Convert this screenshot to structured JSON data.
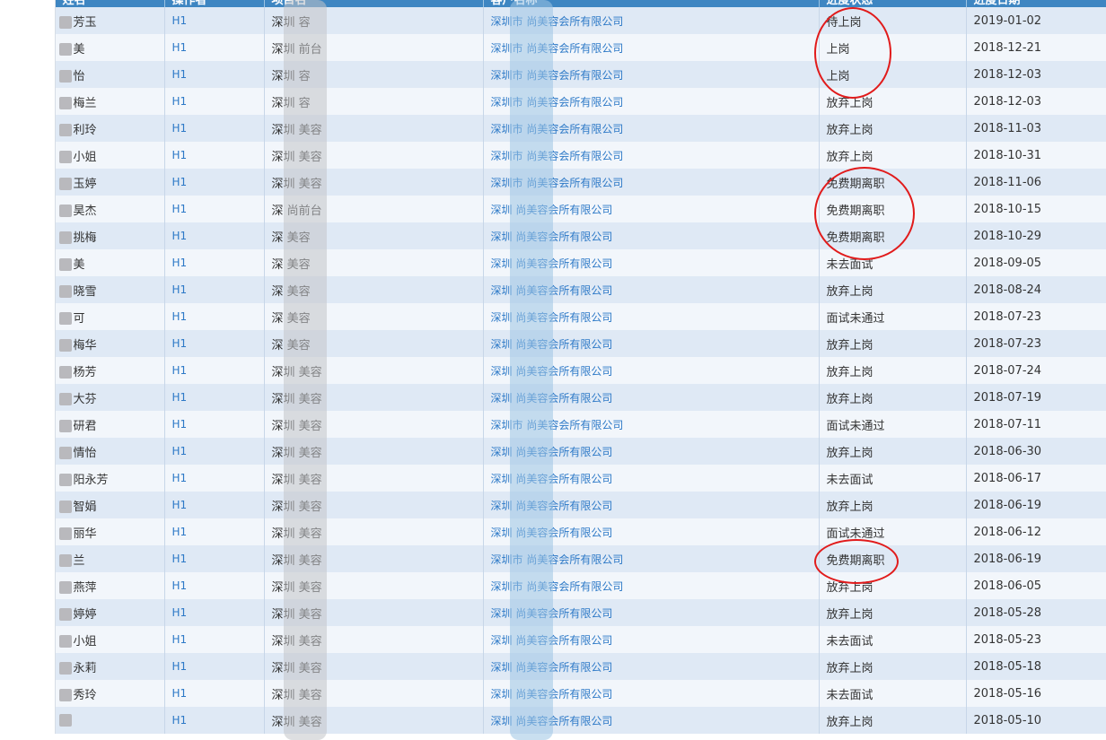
{
  "header": {
    "columns": [
      "姓名",
      "操作者",
      "项目名",
      "客户名称",
      "进度状态",
      "进度日期"
    ]
  },
  "rows": [
    {
      "name": "芳玉",
      "operator": "H1",
      "project": "深圳  容",
      "client": "深圳市  尚美容会所有限公司",
      "status": "待上岗",
      "date": "2019-01-02"
    },
    {
      "name": "美",
      "operator": "H1",
      "project": "深圳  前台",
      "client": "深圳市  尚美容会所有限公司",
      "status": "上岗",
      "date": "2018-12-21"
    },
    {
      "name": "怡",
      "operator": "H1",
      "project": "深圳  容",
      "client": "深圳市  尚美容会所有限公司",
      "status": "上岗",
      "date": "2018-12-03"
    },
    {
      "name": "梅兰",
      "operator": "H1",
      "project": "深圳  容",
      "client": "深圳市  尚美容会所有限公司",
      "status": "放弃上岗",
      "date": "2018-12-03"
    },
    {
      "name": "利玲",
      "operator": "H1",
      "project": "深圳  美容",
      "client": "深圳市  尚美容会所有限公司",
      "status": "放弃上岗",
      "date": "2018-11-03"
    },
    {
      "name": "小姐",
      "operator": "H1",
      "project": "深圳  美容",
      "client": "深圳市  尚美容会所有限公司",
      "status": "放弃上岗",
      "date": "2018-10-31"
    },
    {
      "name": "玉婷",
      "operator": "H1",
      "project": "深圳  美容",
      "client": "深圳市  尚美容会所有限公司",
      "status": "免费期离职",
      "date": "2018-11-06"
    },
    {
      "name": "昊杰",
      "operator": "H1",
      "project": "深  尚前台",
      "client": "深圳  尚美容会所有限公司",
      "status": "免费期离职",
      "date": "2018-10-15"
    },
    {
      "name": "挑梅",
      "operator": "H1",
      "project": "深  美容",
      "client": "深圳  尚美容会所有限公司",
      "status": "免费期离职",
      "date": "2018-10-29"
    },
    {
      "name": "美",
      "operator": "H1",
      "project": "深  美容",
      "client": "深圳  尚美容会所有限公司",
      "status": "未去面试",
      "date": "2018-09-05"
    },
    {
      "name": "晓雪",
      "operator": "H1",
      "project": "深  美容",
      "client": "深圳  尚美容会所有限公司",
      "status": "放弃上岗",
      "date": "2018-08-24"
    },
    {
      "name": "可",
      "operator": "H1",
      "project": "深  美容",
      "client": "深圳  尚美容会所有限公司",
      "status": "面试未通过",
      "date": "2018-07-23"
    },
    {
      "name": "梅华",
      "operator": "H1",
      "project": "深  美容",
      "client": "深圳  尚美容会所有限公司",
      "status": "放弃上岗",
      "date": "2018-07-23"
    },
    {
      "name": "杨芳",
      "operator": "H1",
      "project": "深圳  美容",
      "client": "深圳  尚美容会所有限公司",
      "status": "放弃上岗",
      "date": "2018-07-24"
    },
    {
      "name": "大芬",
      "operator": "H1",
      "project": "深圳  美容",
      "client": "深圳  尚美容会所有限公司",
      "status": "放弃上岗",
      "date": "2018-07-19"
    },
    {
      "name": "研君",
      "operator": "H1",
      "project": "深圳  美容",
      "client": "深圳市  尚美容会所有限公司",
      "status": "面试未通过",
      "date": "2018-07-11"
    },
    {
      "name": "情怡",
      "operator": "H1",
      "project": "深圳  美容",
      "client": "深圳  尚美容会所有限公司",
      "status": "放弃上岗",
      "date": "2018-06-30"
    },
    {
      "name": "阳永芳",
      "operator": "H1",
      "project": "深圳  美容",
      "client": "深圳  尚美容会所有限公司",
      "status": "未去面试",
      "date": "2018-06-17"
    },
    {
      "name": "智娟",
      "operator": "H1",
      "project": "深圳  美容",
      "client": "深圳  尚美容会所有限公司",
      "status": "放弃上岗",
      "date": "2018-06-19"
    },
    {
      "name": "丽华",
      "operator": "H1",
      "project": "深圳  美容",
      "client": "深圳  尚美容会所有限公司",
      "status": "面试未通过",
      "date": "2018-06-12"
    },
    {
      "name": "兰",
      "operator": "H1",
      "project": "深圳  美容",
      "client": "深圳市  尚美容会所有限公司",
      "status": "免费期离职",
      "date": "2018-06-19"
    },
    {
      "name": "燕萍",
      "operator": "H1",
      "project": "深圳  美容",
      "client": "深圳市  尚美容会所有限公司",
      "status": "放弃上岗",
      "date": "2018-06-05"
    },
    {
      "name": "婷婷",
      "operator": "H1",
      "project": "深圳  美容",
      "client": "深圳  尚美容会所有限公司",
      "status": "放弃上岗",
      "date": "2018-05-28"
    },
    {
      "name": "小姐",
      "operator": "H1",
      "project": "深圳  美容",
      "client": "深圳  尚美容会所有限公司",
      "status": "未去面试",
      "date": "2018-05-23"
    },
    {
      "name": "永莉",
      "operator": "H1",
      "project": "深圳  美容",
      "client": "深圳  尚美容会所有限公司",
      "status": "放弃上岗",
      "date": "2018-05-18"
    },
    {
      "name": "秀玲",
      "operator": "H1",
      "project": "深圳  美容",
      "client": "深圳  尚美容会所有限公司",
      "status": "未去面试",
      "date": "2018-05-16"
    },
    {
      "name": "",
      "operator": "H1",
      "project": "深圳  美容",
      "client": "深圳  尚美容会所有限公司",
      "status": "放弃上岗",
      "date": "2018-05-10"
    }
  ],
  "colors": {
    "header_bg": "#3e86c2",
    "row_odd": "#dfe9f5",
    "row_even": "#f2f6fb",
    "link": "#2d79c7",
    "annotation_circle": "#e11b1b"
  }
}
